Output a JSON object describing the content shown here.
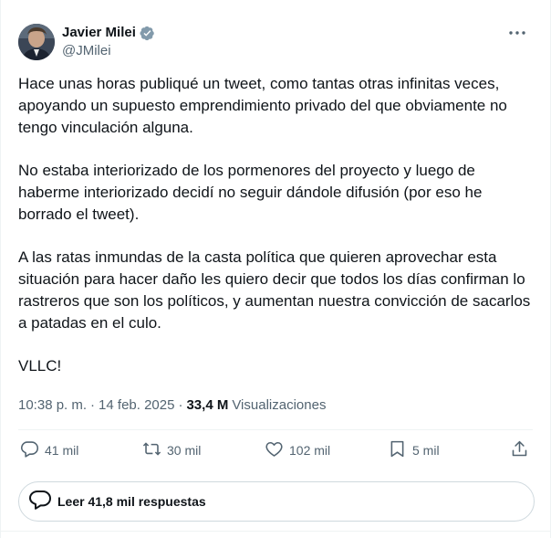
{
  "author": {
    "name": "Javier Milei",
    "handle": "@JMilei",
    "verified": true
  },
  "tweet": {
    "paragraphs": [
      "Hace unas horas publiqué un tweet, como tantas otras infinitas veces, apoyando un supuesto emprendimiento privado del que obviamente no tengo vinculación alguna.",
      "No estaba interiorizado de los pormenores del proyecto y luego de haberme interiorizado decidí no seguir dándole difusión (por eso he borrado el tweet).",
      "A las ratas inmundas de la casta política que quieren aprovechar esta situación para hacer daño les quiero decir que todos los días confirman lo rastreros que son los políticos, y aumentan nuestra convicción de sacarlos a patadas en el culo.",
      "VLLC!"
    ]
  },
  "meta": {
    "time": "10:38 p. m.",
    "separator": "·",
    "date": "14 feb. 2025",
    "views_count": "33,4 M",
    "views_label": "Visualizaciones"
  },
  "actions": {
    "replies": "41 mil",
    "retweets": "30 mil",
    "likes": "102 mil",
    "bookmarks": "5 mil"
  },
  "read_replies": {
    "label": "Leer 41,8 mil respuestas"
  },
  "colors": {
    "verified_badge": "#829aab",
    "secondary_text": "#536471",
    "primary_text": "#0f1419",
    "border": "#cfd9de"
  },
  "icons": [
    "verified-badge-icon",
    "more-icon",
    "reply-icon",
    "retweet-icon",
    "like-icon",
    "bookmark-icon",
    "share-icon",
    "replies-bubble-icon"
  ]
}
